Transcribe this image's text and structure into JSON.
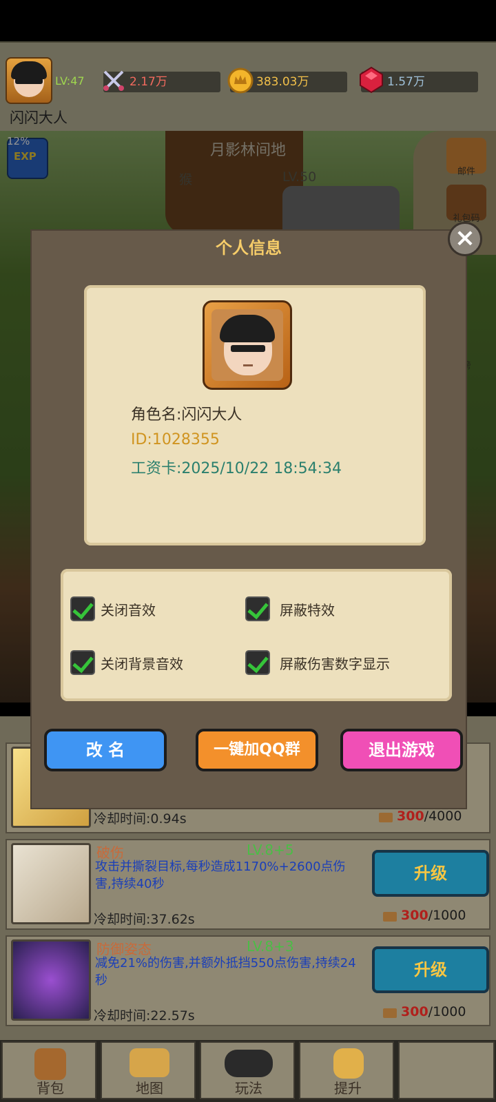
{
  "player": {
    "level": "LV:47",
    "name": "闪闪大人",
    "power": "2.17万",
    "gold": "383.03万",
    "gems": "1.57万"
  },
  "scene": {
    "map_name": "月影林间地",
    "monster": "猴",
    "monster_level": "LV.50",
    "exp_percent": "12%",
    "exp_badge": "EXP"
  },
  "side_menu": {
    "mail": "邮件",
    "gift_code": "礼包码",
    "rank": "榜"
  },
  "dialog": {
    "title": "个人信息",
    "close_icon": "close-icon",
    "role_name": "角色名:闪闪大人",
    "id": "ID:1028355",
    "wage_card": "工资卡:2025/10/22 18:54:34",
    "settings": [
      {
        "label": "关闭音效",
        "checked": true
      },
      {
        "label": "屏蔽特效",
        "checked": true
      },
      {
        "label": "关闭背景音效",
        "checked": true
      },
      {
        "label": "屏蔽伤害数字显示",
        "checked": true
      }
    ],
    "buttons": {
      "rename": "改 名",
      "join_qq": "一键加QQ群",
      "exit": "退出游戏"
    }
  },
  "skills": [
    {
      "cooldown": "冷却时间:0.94s",
      "cost_current": "300",
      "cost_max": "/4000"
    },
    {
      "name": "破伤",
      "level": "LV.8+5",
      "desc": "攻击并撕裂目标,每秒造成1170%+2600点伤害,持续40秒",
      "cooldown": "冷却时间:37.62s",
      "upgrade": "升级",
      "cost_current": "300",
      "cost_max": "/1000"
    },
    {
      "name": "防御姿态",
      "level": "LV.8+3",
      "desc": "减免21%的伤害,并额外抵挡550点伤害,持续24秒",
      "cooldown": "冷却时间:22.57s",
      "upgrade": "升级",
      "cost_current": "300",
      "cost_max": "/1000"
    }
  ],
  "nav": {
    "bag": "背包",
    "map": "地图",
    "play": "玩法",
    "upgrade": "提升"
  },
  "colors": {
    "accent_gold": "#f7cd69",
    "level_green": "#4bbd46",
    "button_blue": "#3f95f3",
    "button_orange": "#f3902b",
    "button_pink": "#f04fb6"
  }
}
